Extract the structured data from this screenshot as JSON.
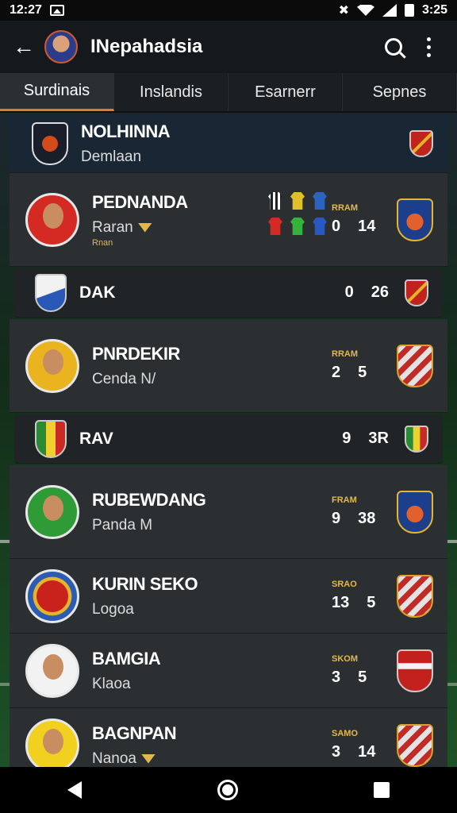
{
  "status_bar": {
    "time": "12:27",
    "right_time": "3:25"
  },
  "app_bar": {
    "title": "INepahadsia"
  },
  "tabs": [
    {
      "label": "Surdinais",
      "active": true
    },
    {
      "label": "Inslandis",
      "active": false
    },
    {
      "label": "Esarnerr",
      "active": false
    },
    {
      "label": "Sepnes",
      "active": false
    }
  ],
  "header_row": {
    "name": "NOLHINNA",
    "sub": "Demlaan"
  },
  "rows": [
    {
      "type": "player",
      "name": "PEDNANDA",
      "sub": "Raran",
      "sub2": "Rnan",
      "stat_label": "RRAM",
      "v1": "0",
      "v2": "14"
    },
    {
      "type": "team",
      "name": "DAK",
      "v1": "0",
      "v2": "26"
    },
    {
      "type": "player",
      "name": "PNRDEKIR",
      "sub": "Cenda N/",
      "stat_label": "RRAM",
      "v1": "2",
      "v2": "5"
    },
    {
      "type": "team",
      "name": "RAV",
      "v1": "9",
      "v2": "3R"
    },
    {
      "type": "player",
      "name": "RUBEWDANG",
      "sub": "Panda M",
      "stat_label": "FRAM",
      "v1": "9",
      "v2": "38"
    },
    {
      "type": "player",
      "name": "KURIN SEKO",
      "sub": "Logoa",
      "stat_label": "SRAO",
      "v1": "13",
      "v2": "5"
    },
    {
      "type": "player",
      "name": "BAMGIA",
      "sub": "Klaoa",
      "stat_label": "SKOM",
      "v1": "3",
      "v2": "5"
    },
    {
      "type": "player",
      "name": "BAGNPAN",
      "sub": "Nanoa",
      "stat_label": "SAMO",
      "v1": "3",
      "v2": "14"
    }
  ]
}
